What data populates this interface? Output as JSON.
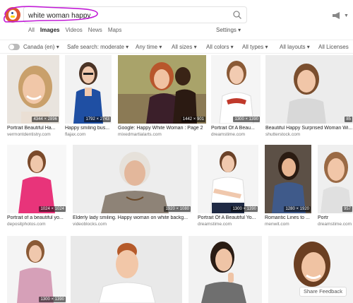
{
  "search": {
    "query": "white woman happy"
  },
  "tabs": [
    "All",
    "Images",
    "Videos",
    "News",
    "Maps"
  ],
  "settings_label": "Settings",
  "filters": {
    "region": "Canada (en)",
    "safe_search": "Safe search: moderate",
    "time": "Any time",
    "size": "All sizes",
    "color": "All colors",
    "type": "All types",
    "layout": "All layouts",
    "license": "All Licenses"
  },
  "results": [
    {
      "title": "Portrait Beautiful Ha...",
      "source": "vermontdentistry.com",
      "dims": "4344 × 2896"
    },
    {
      "title": "Happy smiling bus...",
      "source": "flajax.com",
      "dims": "1792 × 2743"
    },
    {
      "title": "Google: Happy White Woman : Page 2",
      "source": "mixedmartialarts.com",
      "dims": "1442 × 901"
    },
    {
      "title": "Portrait Of A Beau...",
      "source": "dreamstime.com",
      "dims": "1300 × 1390"
    },
    {
      "title": "Beautiful Happy Surprised Woman Wi...",
      "source": "shutterstock.com",
      "dims": "85"
    },
    {
      "title": "Portrait of a beautiful yo...",
      "source": "depositphotos.com",
      "dims": "1024 × 1024"
    },
    {
      "title": "Elderly lady smiling. Happy woman on white backg...",
      "source": "videoblocks.com",
      "dims": "1920 × 1080"
    },
    {
      "title": "Portrait Of A Beautiful Yo...",
      "source": "dreamstime.com",
      "dims": "1300 × 1390"
    },
    {
      "title": "Romantic Lines to ...",
      "source": "menwit.com",
      "dims": "1280 × 1920"
    },
    {
      "title": "Portr",
      "source": "dreamstime.com",
      "dims": "957"
    },
    {
      "title": "",
      "source": "",
      "dims": "1300 × 1390"
    }
  ],
  "share_feedback": "Share Feedback"
}
